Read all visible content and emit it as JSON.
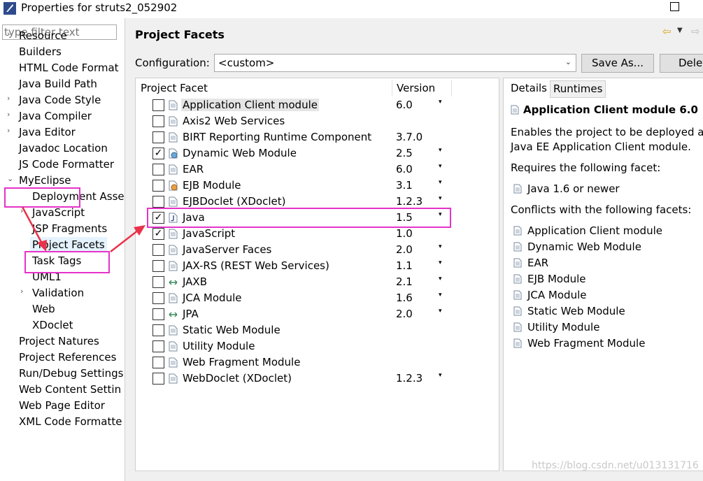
{
  "window": {
    "title": "Properties for struts2_052902"
  },
  "filter": {
    "placeholder": "type filter text"
  },
  "tree": [
    {
      "label": "Resource",
      "expander": "›"
    },
    {
      "label": "Builders",
      "expander": ""
    },
    {
      "label": "HTML Code Format",
      "expander": ""
    },
    {
      "label": "Java Build Path",
      "expander": ""
    },
    {
      "label": "Java Code Style",
      "expander": "›"
    },
    {
      "label": "Java Compiler",
      "expander": "›"
    },
    {
      "label": "Java Editor",
      "expander": "›"
    },
    {
      "label": "Javadoc Location",
      "expander": ""
    },
    {
      "label": "JS Code Formatter",
      "expander": ""
    },
    {
      "label": "MyEclipse",
      "expander": "⌄"
    },
    {
      "label": "Deployment Asse",
      "expander": ""
    },
    {
      "label": "JavaScript",
      "expander": "›"
    },
    {
      "label": "JSP Fragments",
      "expander": ""
    },
    {
      "label": "Project Facets",
      "expander": ""
    },
    {
      "label": "Task Tags",
      "expander": ""
    },
    {
      "label": "UML1",
      "expander": ""
    },
    {
      "label": "Validation",
      "expander": "›"
    },
    {
      "label": "Web",
      "expander": ""
    },
    {
      "label": "XDoclet",
      "expander": ""
    },
    {
      "label": "Project Natures",
      "expander": ""
    },
    {
      "label": "Project References",
      "expander": ""
    },
    {
      "label": "Run/Debug Settings",
      "expander": ""
    },
    {
      "label": "Web Content Settin",
      "expander": ""
    },
    {
      "label": "Web Page Editor",
      "expander": ""
    },
    {
      "label": "XML Code Formatte",
      "expander": ""
    }
  ],
  "page": {
    "title": "Project Facets"
  },
  "config": {
    "label": "Configuration:",
    "value": "<custom>",
    "save_as": "Save As...",
    "delete": "Dele"
  },
  "table": {
    "col_facet": "Project Facet",
    "col_version": "Version",
    "rows": [
      {
        "name": "Application Client module",
        "version": "6.0",
        "checked": false,
        "drop": "▾",
        "icon": "document-icon"
      },
      {
        "name": "Axis2 Web Services",
        "version": "",
        "checked": false,
        "drop": "",
        "icon": "document-icon"
      },
      {
        "name": "BIRT Reporting Runtime Component",
        "version": "3.7.0",
        "checked": false,
        "drop": "",
        "icon": "document-icon"
      },
      {
        "name": "Dynamic Web Module",
        "version": "2.5",
        "checked": true,
        "drop": "▾",
        "icon": "globe-icon"
      },
      {
        "name": "EAR",
        "version": "6.0",
        "checked": false,
        "drop": "▾",
        "icon": "document-icon"
      },
      {
        "name": "EJB Module",
        "version": "3.1",
        "checked": false,
        "drop": "▾",
        "icon": "bean-icon"
      },
      {
        "name": "EJBDoclet (XDoclet)",
        "version": "1.2.3",
        "checked": false,
        "drop": "▾",
        "icon": "document-icon"
      },
      {
        "name": "Java",
        "version": "1.5",
        "checked": true,
        "drop": "▾",
        "icon": "java-icon"
      },
      {
        "name": "JavaScript",
        "version": "1.0",
        "checked": true,
        "drop": "",
        "icon": "document-icon"
      },
      {
        "name": "JavaServer Faces",
        "version": "2.0",
        "checked": false,
        "drop": "▾",
        "icon": "document-icon"
      },
      {
        "name": "JAX-RS (REST Web Services)",
        "version": "1.1",
        "checked": false,
        "drop": "▾",
        "icon": "document-icon"
      },
      {
        "name": "JAXB",
        "version": "2.1",
        "checked": false,
        "drop": "▾",
        "icon": "arrows-icon"
      },
      {
        "name": "JCA Module",
        "version": "1.6",
        "checked": false,
        "drop": "▾",
        "icon": "document-icon"
      },
      {
        "name": "JPA",
        "version": "2.0",
        "checked": false,
        "drop": "▾",
        "icon": "arrows-icon"
      },
      {
        "name": "Static Web Module",
        "version": "",
        "checked": false,
        "drop": "",
        "icon": "document-icon"
      },
      {
        "name": "Utility Module",
        "version": "",
        "checked": false,
        "drop": "",
        "icon": "document-icon"
      },
      {
        "name": "Web Fragment Module",
        "version": "",
        "checked": false,
        "drop": "",
        "icon": "document-icon"
      },
      {
        "name": "WebDoclet (XDoclet)",
        "version": "1.2.3",
        "checked": false,
        "drop": "▾",
        "icon": "document-icon"
      }
    ]
  },
  "details": {
    "tab_details": "Details",
    "tab_runtimes": "Runtimes",
    "heading": "Application Client module 6.0",
    "desc_line1": "Enables the project to be deployed as",
    "desc_line2": "Java EE Application Client module.",
    "requires_label": "Requires the following facet:",
    "requires": [
      "Java 1.6 or newer"
    ],
    "conflicts_label": "Conflicts with the following facets:",
    "conflicts": [
      "Application Client module",
      "Dynamic Web Module",
      "EAR",
      "EJB Module",
      "JCA Module",
      "Static Web Module",
      "Utility Module",
      "Web Fragment Module"
    ]
  },
  "watermark": "https://blog.csdn.net/u013131716",
  "colors": {
    "highlight": "#e533c9",
    "arrow": "#e8334a"
  }
}
